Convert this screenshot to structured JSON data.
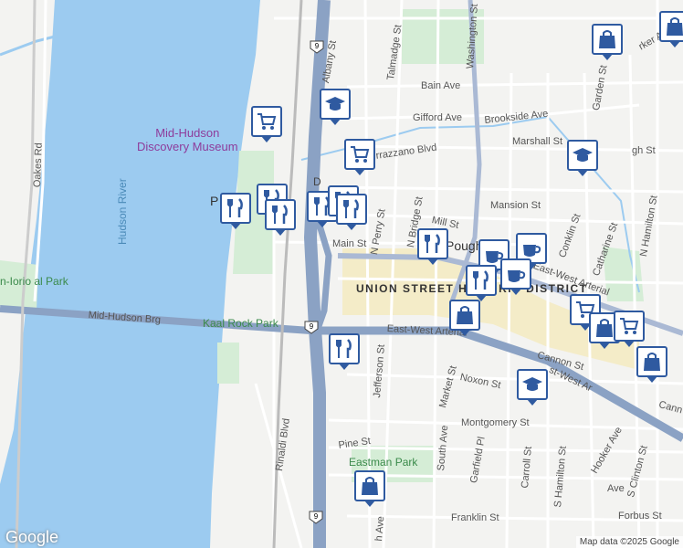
{
  "colors": {
    "water": "#9ccbf0",
    "land": "#f3f3f1",
    "park": "#d5edd6",
    "highway": "#8ba2c4",
    "arterial": "#aab9d4",
    "street": "#ffffff",
    "district": "#f4ecc8",
    "pin_border": "#2f5aa0"
  },
  "labels": {
    "poi_museum": "Mid-Hudson\nDiscovery Museum",
    "park_kaal_rock": "Kaal Rock\nPark",
    "park_eastman": "Eastman Park",
    "park_iorio": "n-Iorio\nal Park",
    "river": "Hudson River",
    "district": "UNION STREET\nHISTORIC\nDISTRICT",
    "town": "Pough",
    "partial_p": "P",
    "partial_d": "D",
    "streets": {
      "albany": "Albany St",
      "talmadge": "Talmadge St",
      "washington": "Washington St",
      "bain": "Bain Ave",
      "gifford": "Gifford Ave",
      "brookside": "Brookside Ave",
      "parker": "rker Ave",
      "garden": "Garden St",
      "marshall": "Marshall St",
      "verrazzano": "rrazzano Blvd",
      "mansion": "Mansion St",
      "mill": "Mill St",
      "main": "Main St",
      "n_perry": "N Perry St",
      "n_bridge": "N Bridge St",
      "conklin": "Conklin St",
      "catharine": "Catharine St",
      "n_hamilton": "N Hamilton St",
      "gh": "gh St",
      "east_west_1": "East-West Arterial",
      "east_west_2": "East-West Arterial",
      "east_west_3": "st-West Ar",
      "mid_hudson_brg": "Mid-Hudson Brg",
      "oakes": "Oakes Rd",
      "rinaldi": "Rinaldi Blvd",
      "jefferson": "Jefferson St",
      "market": "Market St",
      "cannon": "Cannon St",
      "cann": "Cann",
      "noxon": "Noxon St",
      "montgomery": "Montgomery St",
      "pine": "Pine St",
      "south": "South Ave",
      "garfield": "Garfield Pl",
      "carroll": "Carroll St",
      "s_hamilton": "S Hamilton St",
      "hooker": "Hooker Ave",
      "s_clinton": "S Clinton St",
      "forbus": "Forbus St",
      "franklin": "Franklin St",
      "ave_partial": "Ave",
      "h_ave": "h Ave"
    }
  },
  "route_shields": [
    "9",
    "9",
    "9"
  ],
  "markers": [
    {
      "icon": "shopping-cart-icon"
    },
    {
      "icon": "school-icon"
    },
    {
      "icon": "shopping-cart-icon"
    },
    {
      "icon": "shopping-bag-icon"
    },
    {
      "icon": "school-icon"
    },
    {
      "icon": "shopping-bag-icon"
    },
    {
      "icon": "restaurant-icon"
    },
    {
      "icon": "restaurant-icon"
    },
    {
      "icon": "restaurant-icon"
    },
    {
      "icon": "restaurant-icon"
    },
    {
      "icon": "restaurant-icon"
    },
    {
      "icon": "restaurant-icon"
    },
    {
      "icon": "restaurant-icon"
    },
    {
      "icon": "coffee-icon"
    },
    {
      "icon": "coffee-icon"
    },
    {
      "icon": "coffee-icon"
    },
    {
      "icon": "restaurant-icon"
    },
    {
      "icon": "shopping-bag-icon"
    },
    {
      "icon": "shopping-cart-icon"
    },
    {
      "icon": "shopping-bag-icon"
    },
    {
      "icon": "shopping-cart-icon"
    },
    {
      "icon": "shopping-bag-icon"
    },
    {
      "icon": "restaurant-icon"
    },
    {
      "icon": "school-icon"
    },
    {
      "icon": "shopping-bag-icon"
    }
  ],
  "branding": {
    "logo": "Google",
    "attribution": "Map data ©2025 Google"
  }
}
